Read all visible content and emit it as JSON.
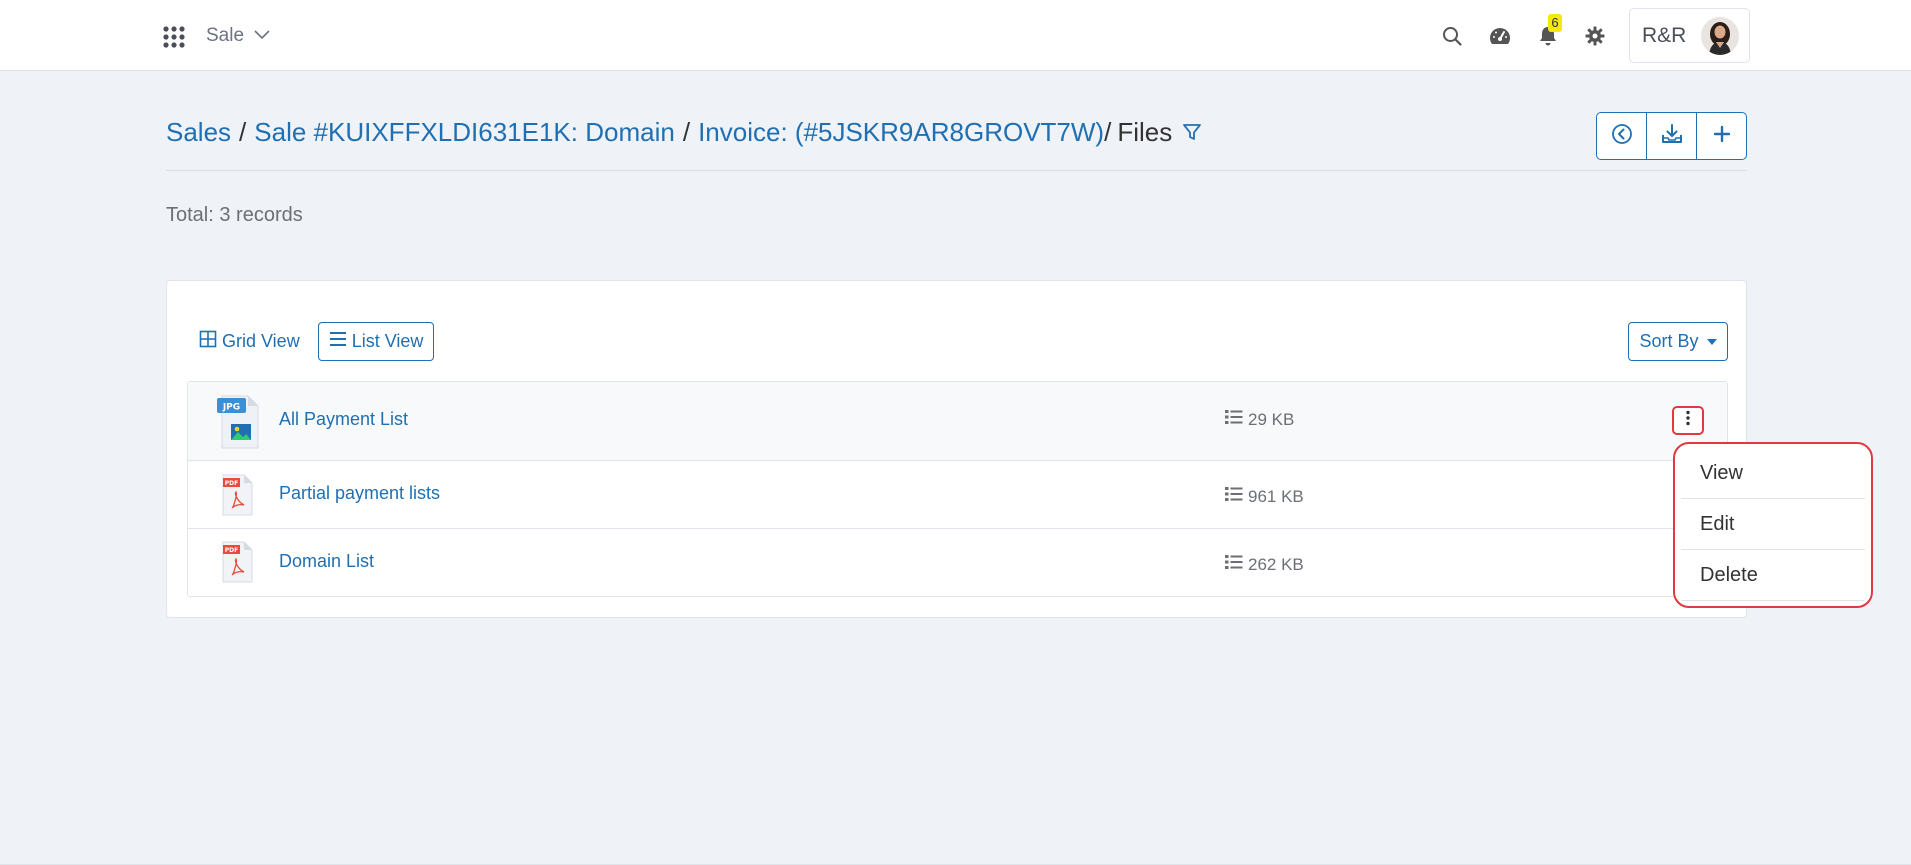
{
  "header": {
    "module_label": "Sale",
    "notification_count": "6",
    "user_initials": "R&R"
  },
  "breadcrumb": {
    "items": [
      "Sales",
      "Sale #KUIXFFXLDI631E1K: Domain",
      "Invoice: (#5JSKR9AR8GROVT7W)"
    ],
    "current": "Files"
  },
  "summary": {
    "total_text": "Total: 3 records"
  },
  "toolbar": {
    "grid_view_label": "Grid View",
    "list_view_label": "List View",
    "sort_label": "Sort By"
  },
  "files": [
    {
      "name": "All Payment List",
      "size": "29 KB",
      "type": "JPG"
    },
    {
      "name": "Partial payment lists",
      "size": "961 KB",
      "type": "PDF"
    },
    {
      "name": "Domain List",
      "size": "262 KB",
      "type": "PDF"
    }
  ],
  "context_menu": {
    "items": [
      "View",
      "Edit",
      "Delete"
    ]
  },
  "colors": {
    "accent": "#1f6fb2",
    "highlight": "#e0393e",
    "badge": "#f4e80c"
  }
}
